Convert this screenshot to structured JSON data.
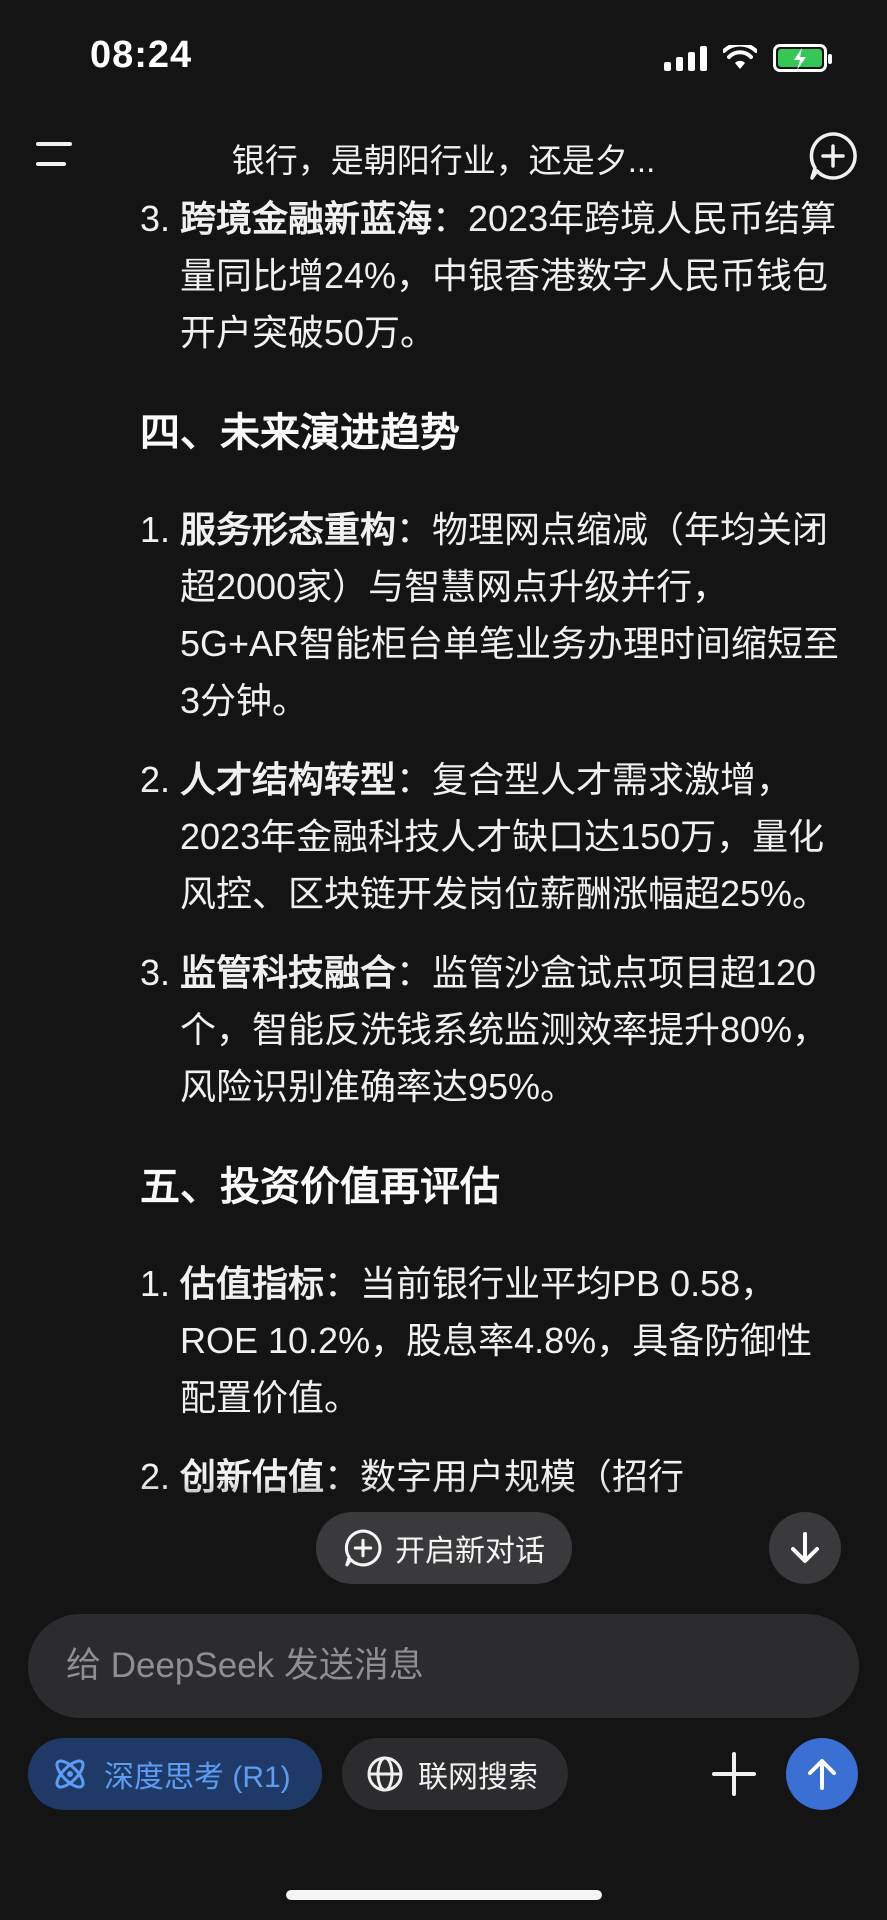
{
  "status": {
    "time": "08:24"
  },
  "header": {
    "title": "银行，是朝阳行业，还是夕..."
  },
  "content": {
    "top_item": {
      "num": "3.",
      "bold": "跨境金融新蓝海",
      "text": "：2023年跨境人民币结算量同比增24%，中银香港数字人民币钱包开户突破50万。"
    },
    "section4": {
      "heading": "四、未来演进趋势",
      "items": [
        {
          "num": "1.",
          "bold": "服务形态重构",
          "text": "：物理网点缩减（年均关闭超2000家）与智慧网点升级并行，5G+AR智能柜台单笔业务办理时间缩短至3分钟。"
        },
        {
          "num": "2.",
          "bold": "人才结构转型",
          "text": "：复合型人才需求激增，2023年金融科技人才缺口达150万，量化风控、区块链开发岗位薪酬涨幅超25%。"
        },
        {
          "num": "3.",
          "bold": "监管科技融合",
          "text": "：监管沙盒试点项目超120个，智能反洗钱系统监测效率提升80%，风险识别准确率达95%。"
        }
      ]
    },
    "section5": {
      "heading": "五、投资价值再评估",
      "items": [
        {
          "num": "1.",
          "bold": "估值指标",
          "text": "：当前银行业平均PB 0.58，ROE 10.2%，股息率4.8%，具备防御性配置价值。"
        },
        {
          "num": "2.",
          "bold": "创新估值",
          "text": "：数字用户规模（招行"
        }
      ]
    }
  },
  "floating": {
    "new_dialog_label": "开启新对话"
  },
  "input": {
    "placeholder": "给 DeepSeek 发送消息"
  },
  "toolbar": {
    "deep_think_label": "深度思考 (R1)",
    "web_search_label": "联网搜索"
  },
  "colors": {
    "background": "#141414",
    "accent_blue": "#3a6fd4",
    "deep_think_bg": "#1f3a66",
    "deep_think_text": "#5d9cf5",
    "battery_green": "#36c759"
  },
  "icons": {
    "menu": "menu-icon",
    "new_chat": "new-chat-icon",
    "scroll_down": "arrow-down-icon",
    "atom": "atom-icon",
    "globe": "globe-icon",
    "plus": "plus-icon",
    "send": "arrow-up-icon"
  }
}
